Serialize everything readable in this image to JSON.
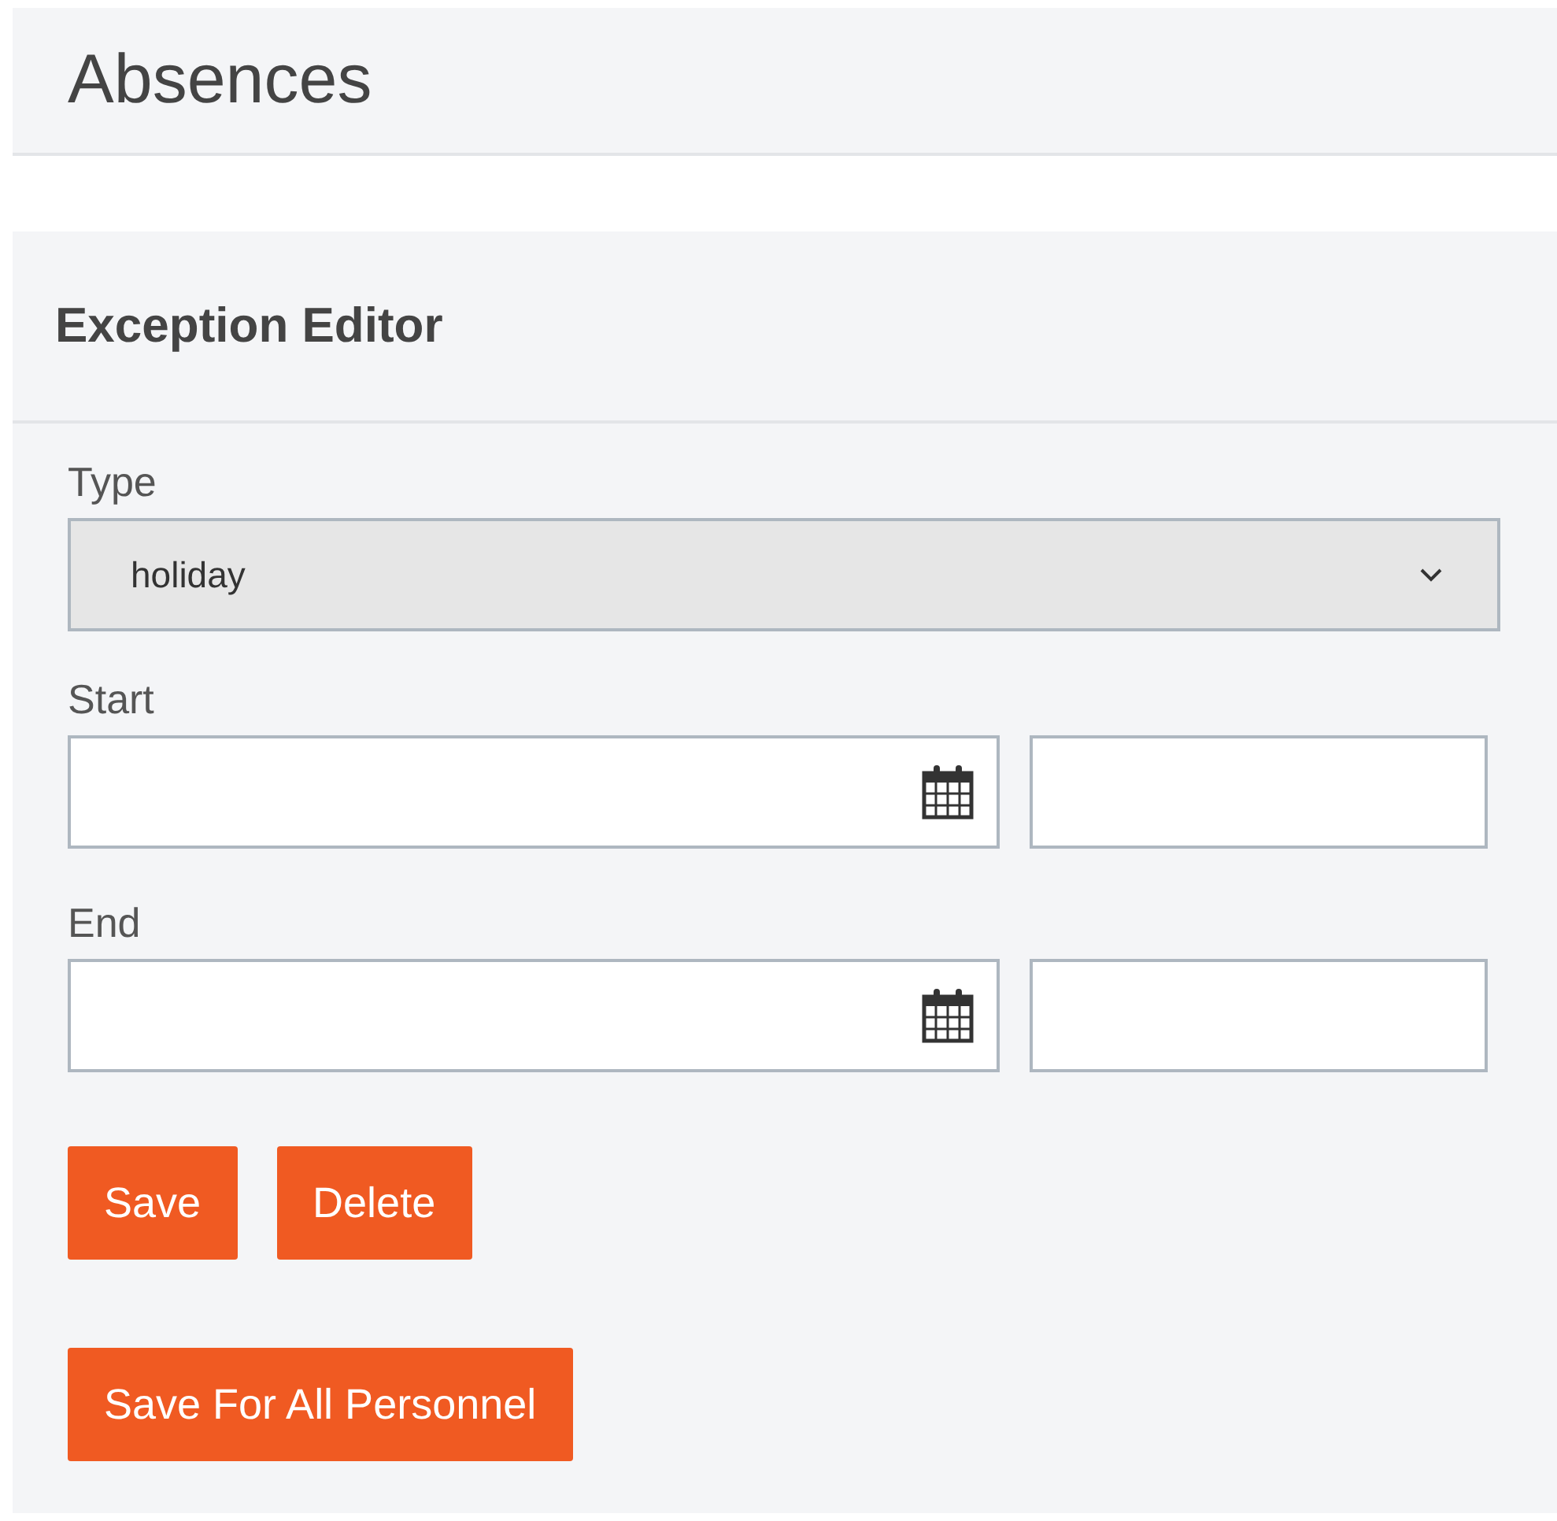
{
  "page_title": "Absences",
  "panel": {
    "title": "Exception Editor",
    "type_field": {
      "label": "Type",
      "value": "holiday"
    },
    "date_fields": [
      {
        "label": "Start"
      },
      {
        "label": "End"
      }
    ],
    "button_rows": [
      [
        "Save",
        "Delete"
      ],
      [
        "Save For All Personnel"
      ]
    ]
  }
}
